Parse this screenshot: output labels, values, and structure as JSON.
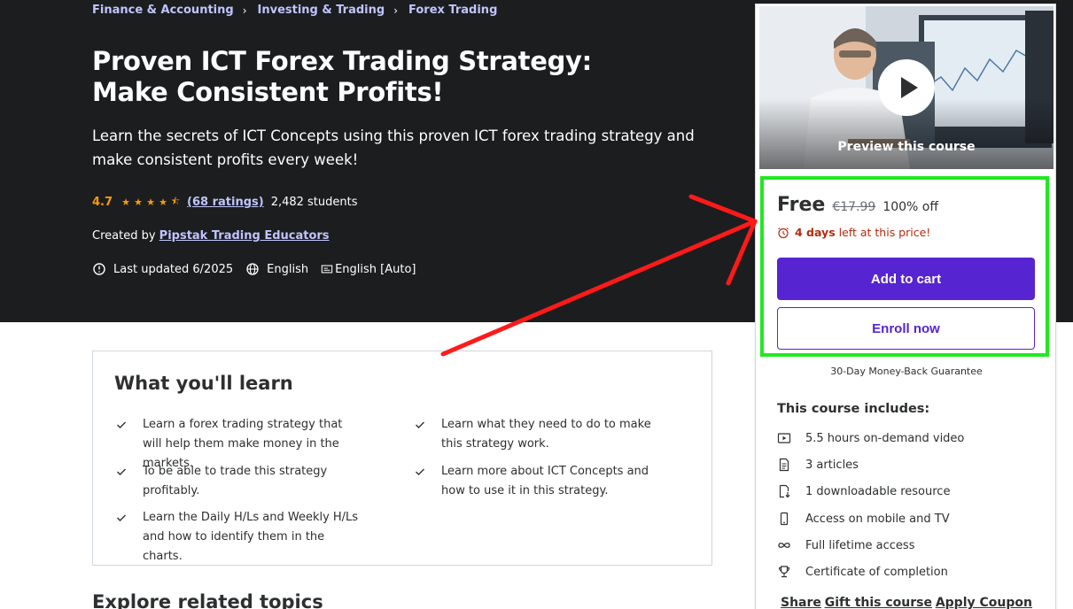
{
  "breadcrumb": {
    "items": [
      "Finance & Accounting",
      "Investing & Trading",
      "Forex Trading"
    ]
  },
  "course": {
    "title": "Proven ICT Forex Trading Strategy: Make Consistent Profits!",
    "subtitle": "Learn the secrets of ICT Concepts using this proven ICT forex trading strategy and make consistent profits every week!",
    "rating": "4.7",
    "rating_stars": 4.7,
    "ratings_count": "(68 ratings)",
    "students": "2,482 students",
    "created_by_label": "Created by",
    "instructor": "Pipstak Trading Educators",
    "last_updated": "Last updated 6/2025",
    "language": "English",
    "captions": "English [Auto]"
  },
  "card": {
    "preview_label": "Preview this course",
    "price": "Free",
    "original_price": "€17.99",
    "discount": "100% off",
    "timer_days": "4 days",
    "timer_text": "left at this price!",
    "add_to_cart": "Add to cart",
    "enroll_now": "Enroll now",
    "guarantee": "30-Day Money-Back Guarantee",
    "includes_title": "This course includes:",
    "includes": [
      {
        "icon": "video-icon",
        "label": "5.5 hours on-demand video"
      },
      {
        "icon": "article-icon",
        "label": "3 articles"
      },
      {
        "icon": "download-icon",
        "label": "1 downloadable resource"
      },
      {
        "icon": "mobile-icon",
        "label": "Access on mobile and TV"
      },
      {
        "icon": "infinity-icon",
        "label": "Full lifetime access"
      },
      {
        "icon": "trophy-icon",
        "label": "Certificate of completion"
      }
    ],
    "links": [
      "Share",
      "Gift this course",
      "Apply Coupon"
    ]
  },
  "learn": {
    "title": "What you'll learn",
    "items": [
      "Learn a forex trading strategy that will help them make money in the markets.",
      "Learn what they need to do to make this strategy work.",
      "To be able to trade this strategy profitably.",
      "Learn more about ICT Concepts and how to use it in this strategy.",
      "Learn the Daily H/Ls and Weekly H/Ls and how to identify them in the charts."
    ]
  },
  "related": {
    "title": "Explore related topics"
  },
  "colors": {
    "hero_bg": "#1c1d1f",
    "accent": "#5624d0",
    "link_light": "#c0c4fc",
    "star": "#f69c08",
    "timer_red": "#b32d0f",
    "highlight_green": "#22e822",
    "arrow_red": "#ff1a1a"
  }
}
